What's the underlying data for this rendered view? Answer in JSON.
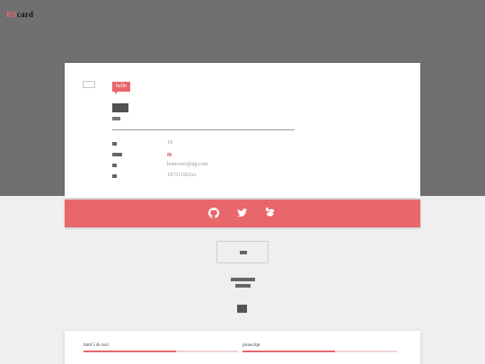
{
  "brand": {
    "part1": "RS",
    "part2": "card"
  },
  "nav": {
    "items": [
      "",
      "",
      "",
      "",
      "",
      "",
      "",
      ""
    ]
  },
  "card": {
    "avatar_icon": "avatar-image-icon",
    "greeting": "hello",
    "info": [
      {
        "value": "18"
      },
      {
        "value": ""
      },
      {
        "value": "botaowei@qq.com"
      },
      {
        "value": "187211962xx"
      }
    ]
  },
  "social": {
    "icons": [
      "github-icon",
      "twitter-icon",
      "weibo-icon"
    ],
    "color": "#e8676b"
  },
  "skills": [
    {
      "label": "html 5 & css3",
      "level": 0.6
    },
    {
      "label": "javascript",
      "level": 0.6
    }
  ],
  "colors": {
    "accent": "#e8676b",
    "header_bg": "#707070",
    "page_bg": "#efefef"
  }
}
